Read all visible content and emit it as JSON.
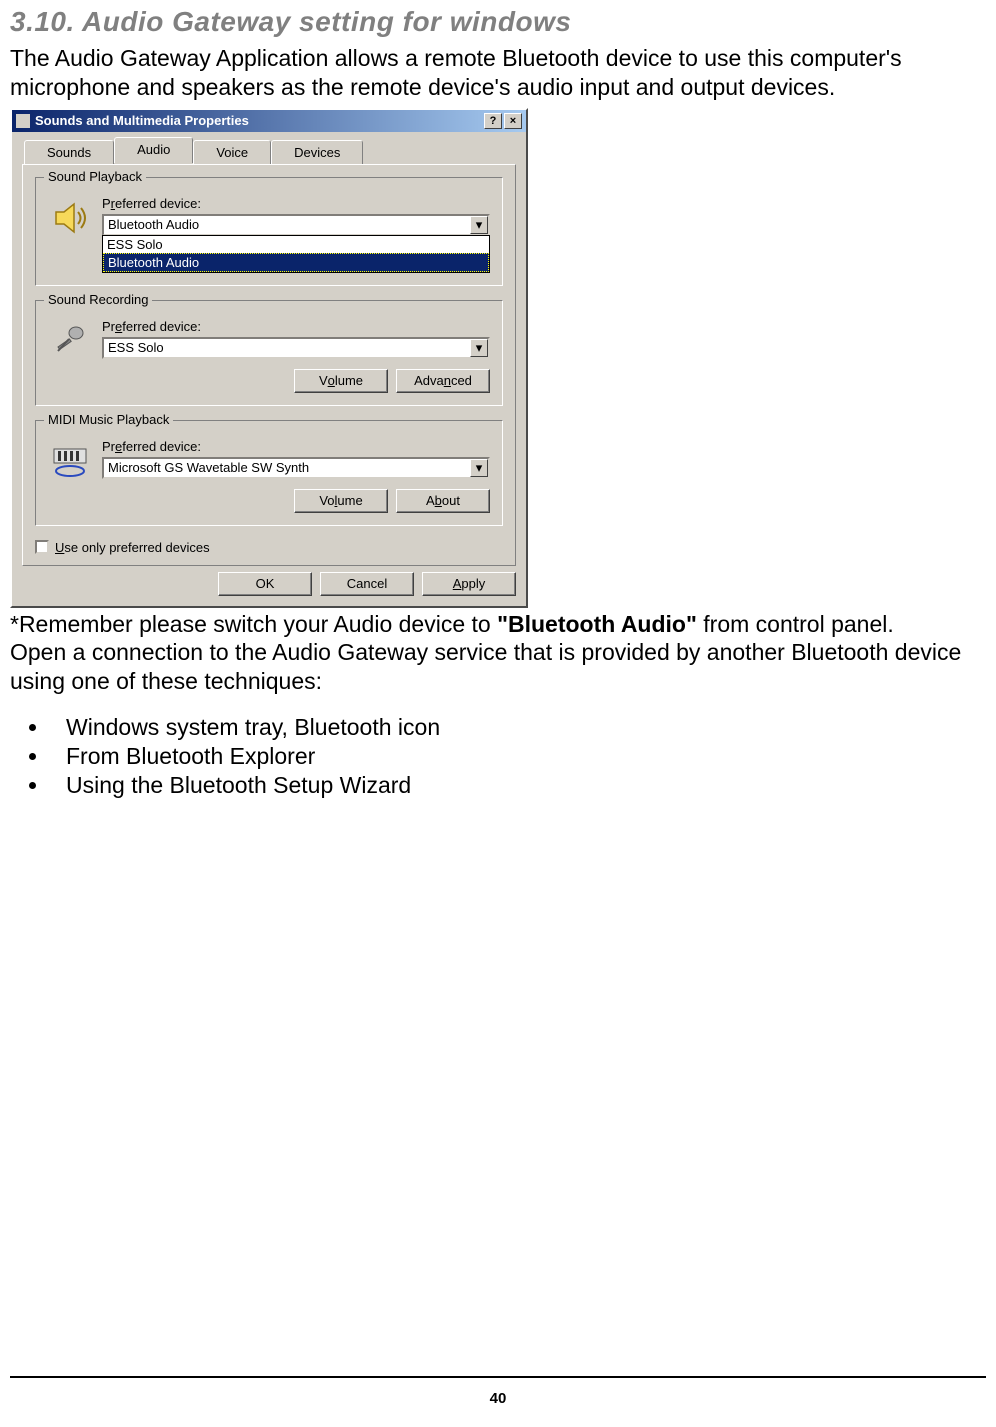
{
  "section": {
    "heading": "3.10. Audio Gateway setting for windows",
    "intro": "The Audio Gateway Application allows a remote Bluetooth device to use this computer's microphone and speakers as the remote device's audio input and output devices."
  },
  "dialog": {
    "title": "Sounds and Multimedia Properties",
    "help_char": "?",
    "close_char": "×",
    "tabs": {
      "sounds": "Sounds",
      "audio": "Audio",
      "voice": "Voice",
      "devices": "Devices"
    },
    "playback": {
      "legend": "Sound Playback",
      "pref_label": "Preferred device:",
      "selected": "Bluetooth Audio",
      "options": {
        "ess": "ESS Solo",
        "bt": "Bluetooth Audio"
      }
    },
    "recording": {
      "legend": "Sound Recording",
      "pref_label": "Preferred device:",
      "selected": "ESS Solo",
      "volume": "Volume",
      "advanced": "Advanced"
    },
    "midi": {
      "legend": "MIDI Music Playback",
      "pref_label": "Preferred device:",
      "selected": "Microsoft GS Wavetable SW Synth",
      "volume": "Volume",
      "about": "About"
    },
    "use_only": "Use only preferred devices",
    "buttons": {
      "ok": "OK",
      "cancel": "Cancel",
      "apply": "Apply"
    }
  },
  "aftertext": {
    "line1a": "*Remember please switch your Audio device to ",
    "line1b": "\"Bluetooth Audio\"",
    "line1c": " from control panel.",
    "line2": "Open a connection to the Audio Gateway service that is provided by another Bluetooth device using one of these techniques:"
  },
  "techniques": {
    "a": "Windows system tray, Bluetooth icon",
    "b": "From Bluetooth Explorer",
    "c": "Using the Bluetooth Setup Wizard"
  },
  "page_number": "40"
}
